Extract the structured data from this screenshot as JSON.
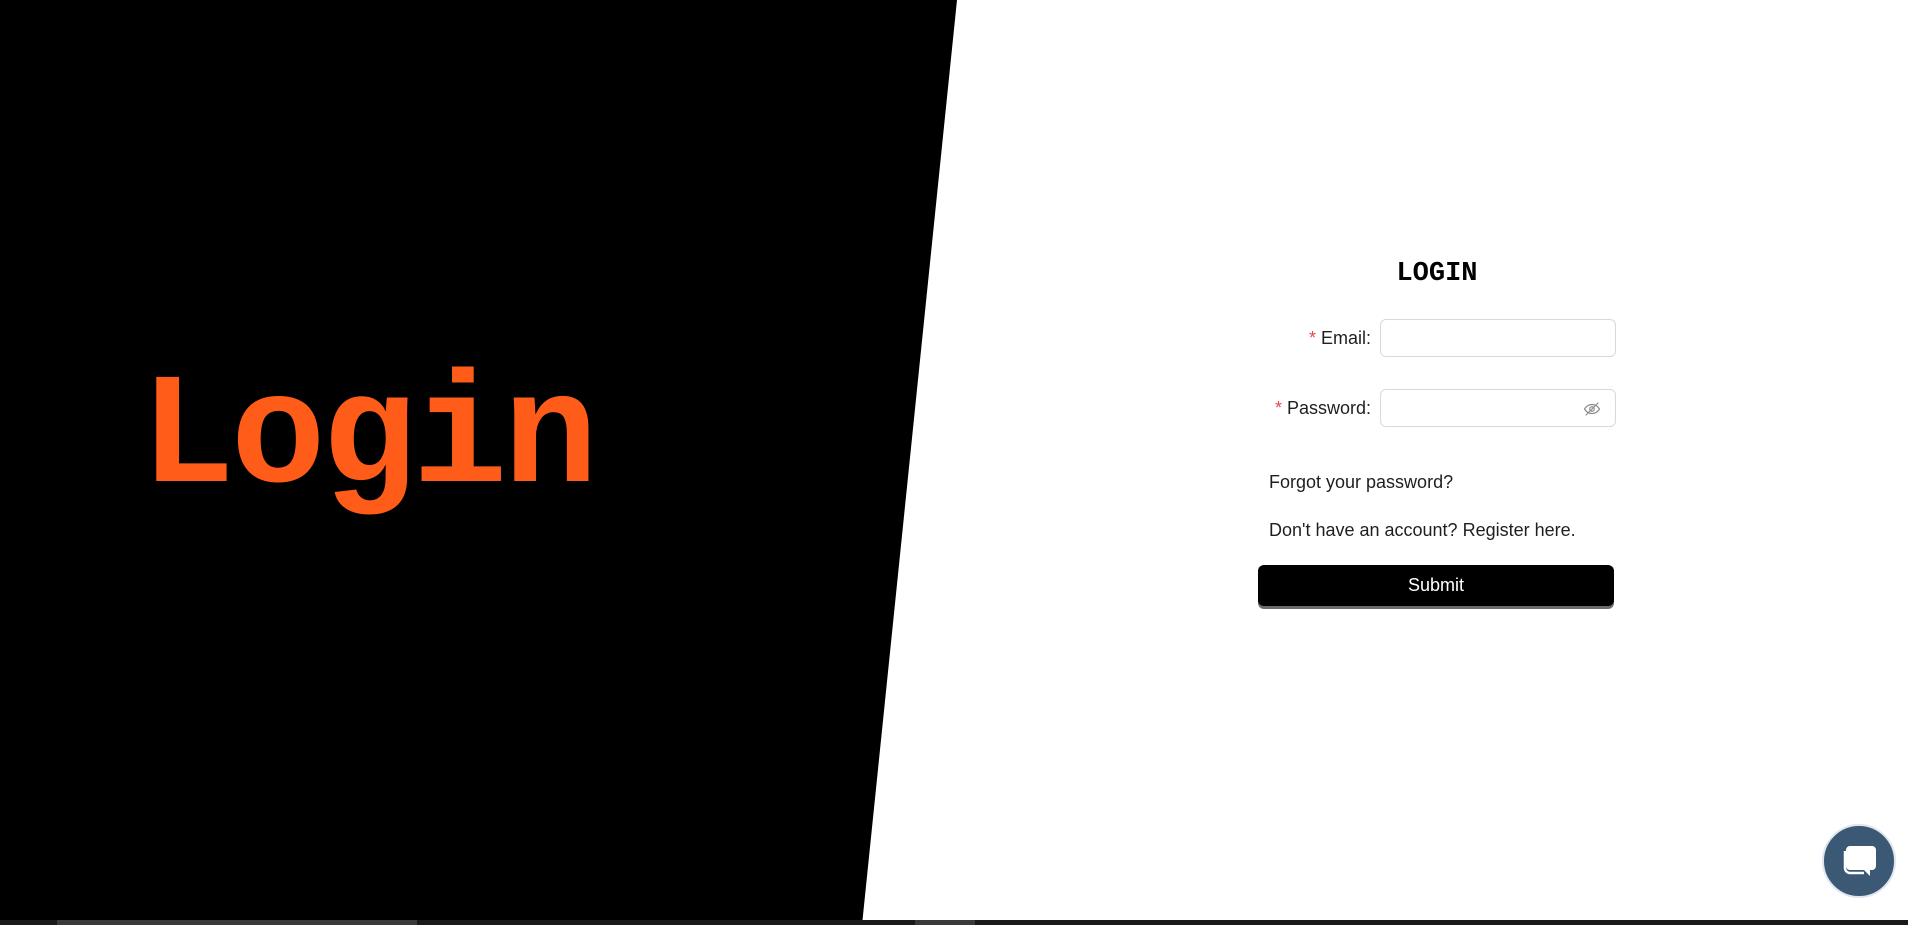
{
  "hero": {
    "title": "Login"
  },
  "form": {
    "title": "LOGIN",
    "email": {
      "label": "Email",
      "required_mark": "*",
      "value": "",
      "placeholder": ""
    },
    "password": {
      "label": "Password",
      "required_mark": "*",
      "value": "",
      "placeholder": "",
      "toggle_icon": "eye-invisible-icon"
    },
    "label_separator": ":",
    "forgot_link": "Forgot your password?",
    "register_link": "Don't have an account? Register here.",
    "submit_label": "Submit"
  },
  "chat": {
    "icon": "chat-bubble-icon"
  },
  "colors": {
    "accent": "#ff5c1a",
    "left_background": "#000000",
    "required": "#e5484d",
    "chat_widget": "#3b5875"
  }
}
